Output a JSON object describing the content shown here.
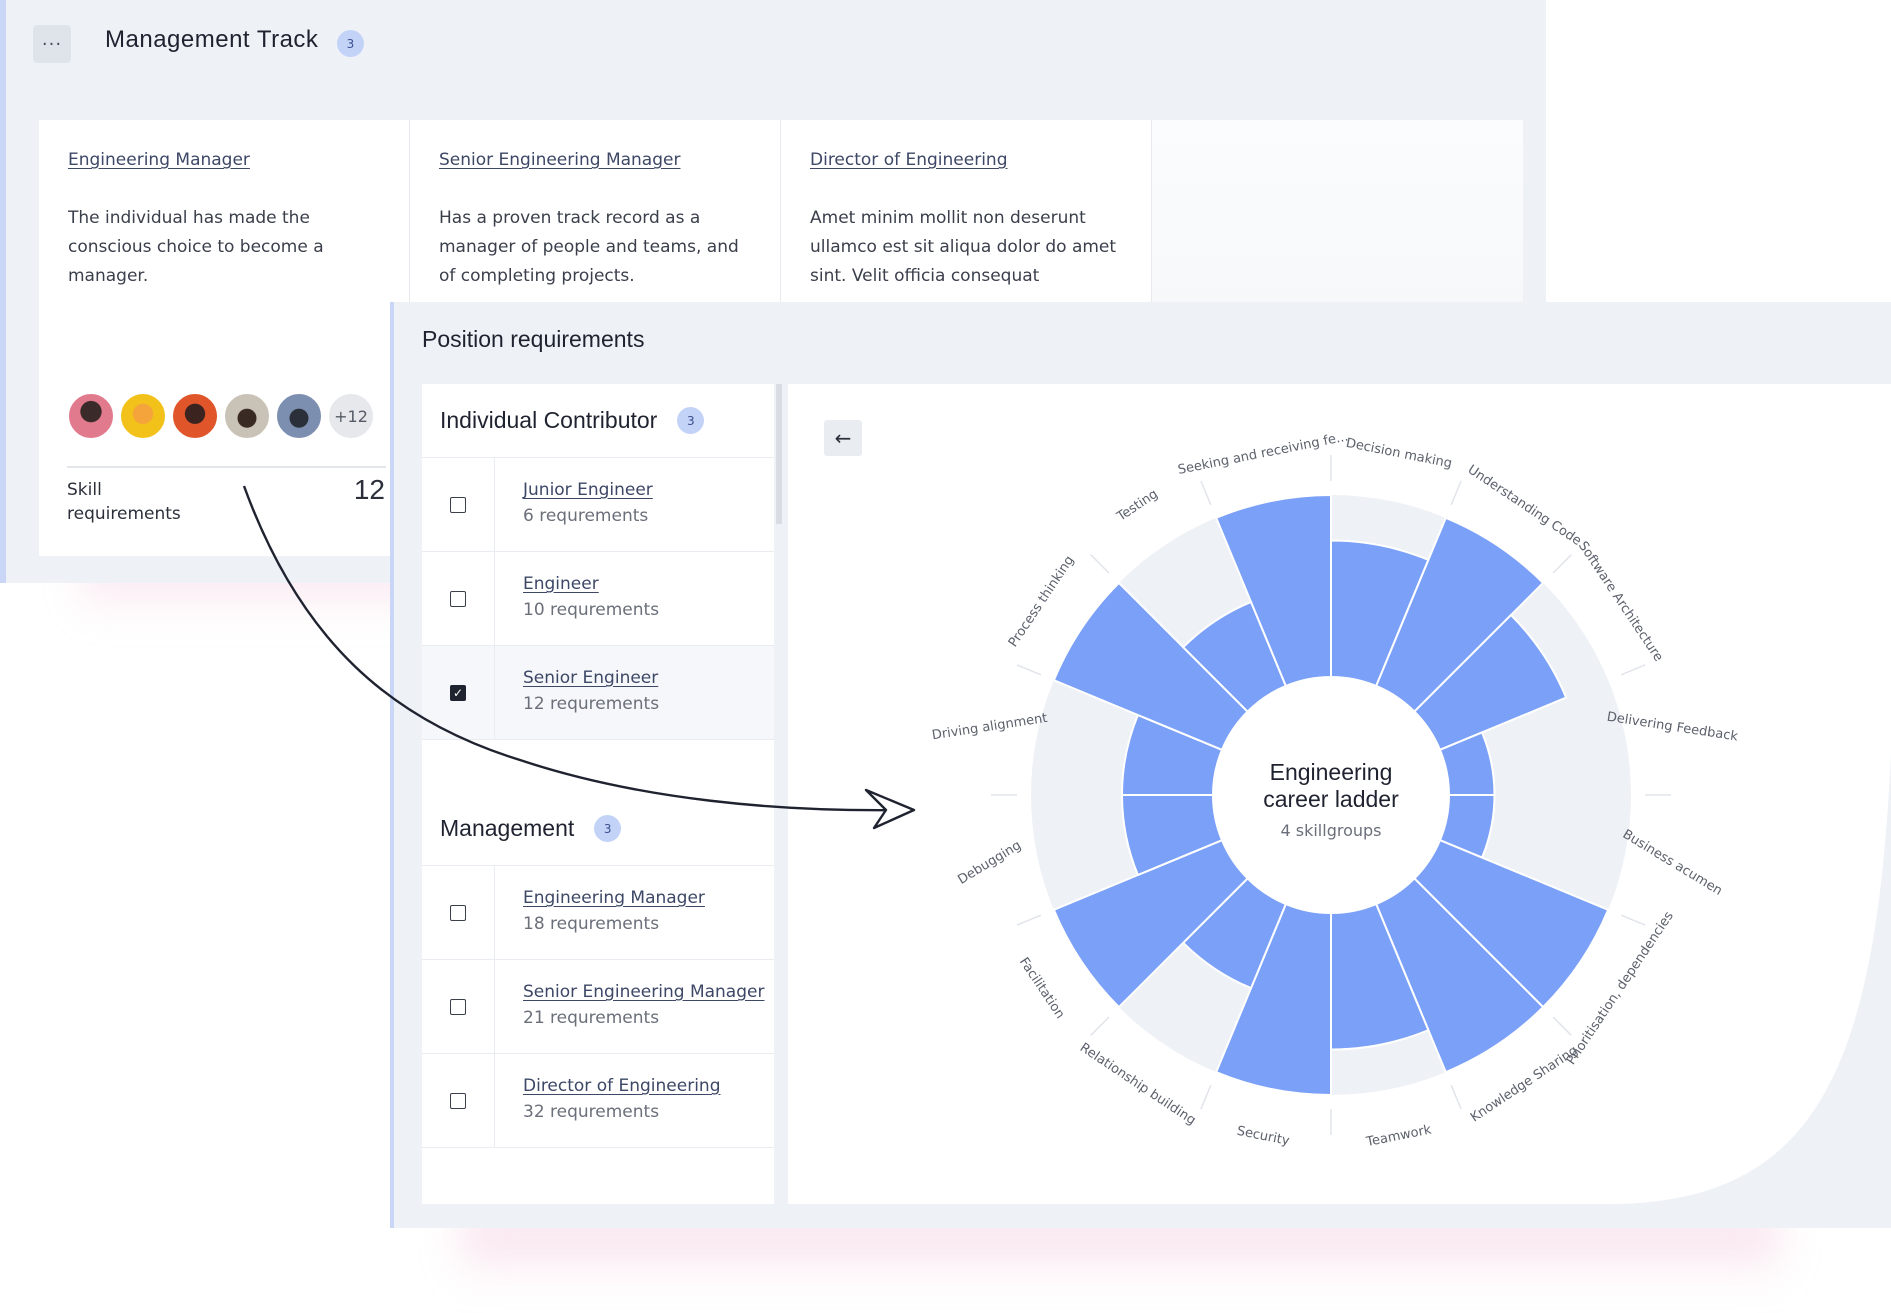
{
  "track": {
    "menu_label": "···",
    "title": "Management Track",
    "badge": "3",
    "cards": [
      {
        "title": "Engineering Manager",
        "desc": "The individual has made the conscious choice to become a manager."
      },
      {
        "title": "Senior Engineering Manager",
        "desc": "Has a proven track record as a manager of people and teams, and of completing projects."
      },
      {
        "title": "Director of Engineering",
        "desc": "Amet minim mollit non deserunt ullamco est sit aliqua dolor do amet sint. Velit officia consequat"
      }
    ],
    "avatars_more": "+12",
    "skill_label": "Skill requirements",
    "skill_count": "12"
  },
  "colors": {
    "accent": "#7ba0f8",
    "ring_bg": "#eef1f5",
    "badge_bg": "#c3d3f8"
  },
  "position": {
    "title": "Position requirements",
    "groups": [
      {
        "name": "Individual Contributor",
        "badge": "3",
        "rows": [
          {
            "title": "Junior Engineer",
            "sub": "6 requrements",
            "checked": false
          },
          {
            "title": "Engineer",
            "sub": "10 requrements",
            "checked": false
          },
          {
            "title": "Senior Engineer",
            "sub": "12 requrements",
            "checked": true
          }
        ]
      },
      {
        "name": "Management",
        "badge": "3",
        "rows": [
          {
            "title": "Engineering Manager",
            "sub": "18 requrements",
            "checked": false
          },
          {
            "title": "Senior Engineering Manager",
            "sub": "21 requrements",
            "checked": false
          },
          {
            "title": "Director of Engineering",
            "sub": "32 requrements",
            "checked": false
          }
        ]
      }
    ],
    "back_icon": "←",
    "check_icon": "✓"
  },
  "chart_data": {
    "type": "polar-bar",
    "center_title": "Engineering career ladder",
    "center_sub": "4 skillgroups",
    "max": 4,
    "categories": [
      {
        "label": "Decision making",
        "value": 3
      },
      {
        "label": "Understanding Code",
        "value": 4
      },
      {
        "label": "Software Architecture",
        "value": 3
      },
      {
        "label": "Delivering Feedback",
        "value": 1
      },
      {
        "label": "Business acumen",
        "value": 1
      },
      {
        "label": "Prioritisation, dependencies",
        "value": 4
      },
      {
        "label": "Knowledge Sharing",
        "value": 4
      },
      {
        "label": "Teamwork",
        "value": 3
      },
      {
        "label": "Security",
        "value": 4
      },
      {
        "label": "Relationship building",
        "value": 2
      },
      {
        "label": "Facilitation",
        "value": 4
      },
      {
        "label": "Debugging",
        "value": 2
      },
      {
        "label": "Driving alignment",
        "value": 2
      },
      {
        "label": "Process thinking",
        "value": 4
      },
      {
        "label": "Testing",
        "value": 2
      },
      {
        "label": "Seeking and receiving fe...",
        "value": 4
      }
    ]
  }
}
